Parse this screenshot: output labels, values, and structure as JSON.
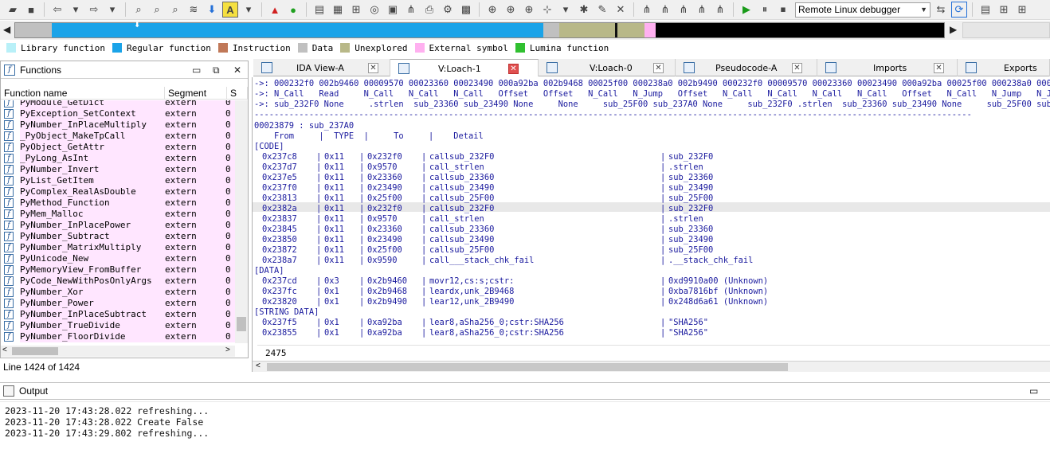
{
  "toolbar": {
    "debugger": "Remote Linux debugger",
    "colors": {
      "run": "#1a9b1a",
      "debug_chip": "#2470d8"
    }
  },
  "legend": [
    {
      "label": "Library function",
      "color": "#b8f0f8"
    },
    {
      "label": "Regular function",
      "color": "#1aa3e8"
    },
    {
      "label": "Instruction",
      "color": "#c07858"
    },
    {
      "label": "Data",
      "color": "#c0c0c0"
    },
    {
      "label": "Unexplored",
      "color": "#b8b888"
    },
    {
      "label": "External symbol",
      "color": "#ffb0f0"
    },
    {
      "label": "Lumina function",
      "color": "#30c030"
    }
  ],
  "functions": {
    "title": "Functions",
    "columns": [
      "Function name",
      "Segment",
      "S"
    ],
    "rows": [
      {
        "name": "PyModule_GetDict",
        "segment": "extern",
        "s": "0"
      },
      {
        "name": "PyException_SetContext",
        "segment": "extern",
        "s": "0"
      },
      {
        "name": "PyNumber_InPlaceMultiply",
        "segment": "extern",
        "s": "0"
      },
      {
        "name": "_PyObject_MakeTpCall",
        "segment": "extern",
        "s": "0"
      },
      {
        "name": "PyObject_GetAttr",
        "segment": "extern",
        "s": "0"
      },
      {
        "name": "_PyLong_AsInt",
        "segment": "extern",
        "s": "0"
      },
      {
        "name": "PyNumber_Invert",
        "segment": "extern",
        "s": "0"
      },
      {
        "name": "PyList_GetItem",
        "segment": "extern",
        "s": "0"
      },
      {
        "name": "PyComplex_RealAsDouble",
        "segment": "extern",
        "s": "0"
      },
      {
        "name": "PyMethod_Function",
        "segment": "extern",
        "s": "0"
      },
      {
        "name": "PyMem_Malloc",
        "segment": "extern",
        "s": "0"
      },
      {
        "name": "PyNumber_InPlacePower",
        "segment": "extern",
        "s": "0"
      },
      {
        "name": "PyNumber_Subtract",
        "segment": "extern",
        "s": "0"
      },
      {
        "name": "PyNumber_MatrixMultiply",
        "segment": "extern",
        "s": "0"
      },
      {
        "name": "PyUnicode_New",
        "segment": "extern",
        "s": "0"
      },
      {
        "name": "PyMemoryView_FromBuffer",
        "segment": "extern",
        "s": "0"
      },
      {
        "name": "PyCode_NewWithPosOnlyArgs",
        "segment": "extern",
        "s": "0"
      },
      {
        "name": "PyNumber_Xor",
        "segment": "extern",
        "s": "0"
      },
      {
        "name": "PyNumber_Power",
        "segment": "extern",
        "s": "0"
      },
      {
        "name": "PyNumber_InPlaceSubtract",
        "segment": "extern",
        "s": "0"
      },
      {
        "name": "PyNumber_TrueDivide",
        "segment": "extern",
        "s": "0"
      },
      {
        "name": "PyNumber_FloorDivide",
        "segment": "extern",
        "s": "0"
      }
    ],
    "status": "Line 1424 of 1424"
  },
  "tabs": [
    {
      "label": "IDA View-A"
    },
    {
      "label": "V:Loach-1"
    },
    {
      "label": "V:Loach-0"
    },
    {
      "label": "Pseudocode-A"
    },
    {
      "label": "Imports"
    },
    {
      "label": "Exports"
    }
  ],
  "xref": {
    "header_lines": [
      "->: 000232f0 002b9460 00009570 00023360 00023490 000a92ba 002b9468 00025f00 000238a0 002b9490 000232f0 00009570 00023360 00023490 000a92ba 00025f00 000238a0 000238a7 0",
      "->: N_Call   Read     N_Call   N_Call   N_Call   Offset   Offset   N_Call   N_Jump   Offset   N_Call   N_Call   N_Call   N_Call   Offset   N_Call   N_Jump   N_Jump   O",
      "->: sub_232F0 None     .strlen  sub_23360 sub_23490 None     None     sub_25F00 sub_237A0 None     sub_232F0 .strlen  sub_23360 sub_23490 None     sub_25F00 sub_237A0 N",
      "------------------------------------------------------------------------------------------------------------------------------------------------"
    ],
    "target_line": "00023879 : sub_237A0",
    "table_header": "    From     |  TYPE  |     To     |    Detail",
    "sections": [
      {
        "title": "[CODE]",
        "rows": [
          {
            "from": "0x237c8",
            "type": "0x11",
            "to": "0x232f0",
            "detail": "callsub_232F0",
            "target": "sub_232F0"
          },
          {
            "from": "0x237d7",
            "type": "0x11",
            "to": "0x9570",
            "detail": "call_strlen",
            "target": ".strlen"
          },
          {
            "from": "0x237e5",
            "type": "0x11",
            "to": "0x23360",
            "detail": "callsub_23360",
            "target": "sub_23360"
          },
          {
            "from": "0x237f0",
            "type": "0x11",
            "to": "0x23490",
            "detail": "callsub_23490",
            "target": "sub_23490"
          },
          {
            "from": "0x23813",
            "type": "0x11",
            "to": "0x25f00",
            "detail": "callsub_25F00",
            "target": "sub_25F00"
          },
          {
            "from": "0x2382a",
            "type": "0x11",
            "to": "0x232f0",
            "detail": "callsub_232F0",
            "target": "sub_232F0"
          },
          {
            "from": "0x23837",
            "type": "0x11",
            "to": "0x9570",
            "detail": "call_strlen",
            "target": ".strlen"
          },
          {
            "from": "0x23845",
            "type": "0x11",
            "to": "0x23360",
            "detail": "callsub_23360",
            "target": "sub_23360"
          },
          {
            "from": "0x23850",
            "type": "0x11",
            "to": "0x23490",
            "detail": "callsub_23490",
            "target": "sub_23490"
          },
          {
            "from": "0x23872",
            "type": "0x11",
            "to": "0x25f00",
            "detail": "callsub_25F00",
            "target": "sub_25F00"
          },
          {
            "from": "0x238a7",
            "type": "0x11",
            "to": "0x9590",
            "detail": "call___stack_chk_fail",
            "target": ".__stack_chk_fail"
          }
        ]
      },
      {
        "title": "[DATA]",
        "rows": [
          {
            "from": "0x237cd",
            "type": "0x3",
            "to": "0x2b9460",
            "detail": "movr12,cs:s;cstr:",
            "target": "0xd9910a00 (Unknown)"
          },
          {
            "from": "0x237fc",
            "type": "0x1",
            "to": "0x2b9468",
            "detail": "leardx,unk_2B9468",
            "target": "0xba7816bf (Unknown)"
          },
          {
            "from": "0x23820",
            "type": "0x1",
            "to": "0x2b9490",
            "detail": "lear12,unk_2B9490",
            "target": "0x248d6a61 (Unknown)"
          }
        ]
      },
      {
        "title": "[STRING DATA]",
        "rows": [
          {
            "from": "0x237f5",
            "type": "0x1",
            "to": "0xa92ba",
            "detail": "lear8,aSha256_0;cstr:SHA256",
            "target": "\"SHA256\""
          },
          {
            "from": "0x23855",
            "type": "0x1",
            "to": "0xa92ba",
            "detail": "lear8,aSha256_0;cstr:SHA256",
            "target": "\"SHA256\""
          }
        ]
      }
    ],
    "status_value": "2475"
  },
  "output": {
    "title": "Output",
    "lines": [
      "2023-11-20 17:43:28.022 refreshing...",
      "2023-11-20 17:43:28.022 Create False",
      "2023-11-20 17:43:29.802 refreshing..."
    ]
  }
}
